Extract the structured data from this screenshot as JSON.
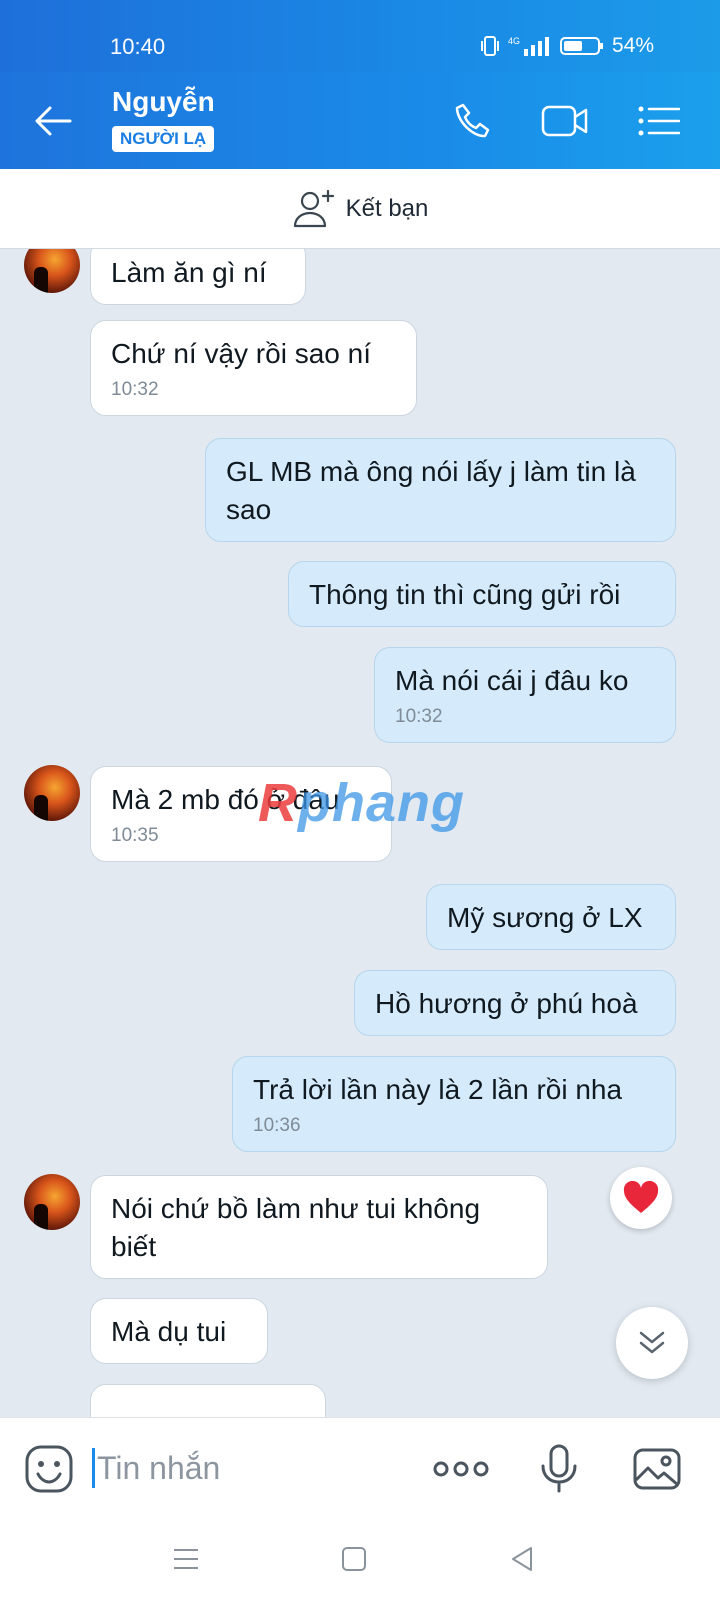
{
  "status": {
    "time": "10:40",
    "network": "4G",
    "battery": "54%"
  },
  "header": {
    "contact_name": "Nguyễn",
    "badge": "NGƯỜI LẠ"
  },
  "friend_bar": {
    "label": "Kết bạn"
  },
  "messages": [
    {
      "side": "in",
      "text": "Làm ăn gì ní",
      "time": ""
    },
    {
      "side": "in",
      "text": "Chứ ní vậy rồi sao ní",
      "time": "10:32"
    },
    {
      "side": "out",
      "text": "GL MB mà ông nói lấy j làm tin là sao",
      "time": ""
    },
    {
      "side": "out",
      "text": "Thông tin thì cũng gửi rồi",
      "time": ""
    },
    {
      "side": "out",
      "text": "Mà nói cái j đâu ko",
      "time": "10:32"
    },
    {
      "side": "in",
      "text": "Mà 2 mb đó ở đâu",
      "time": "10:35"
    },
    {
      "side": "out",
      "text": "Mỹ sương ở LX",
      "time": ""
    },
    {
      "side": "out",
      "text": "Hồ hương ở phú hoà",
      "time": ""
    },
    {
      "side": "out",
      "text": "Trả lời lần này là 2 lần rồi nha",
      "time": "10:36"
    },
    {
      "side": "in",
      "text": "Nói chứ bồ làm như tui không biết",
      "time": ""
    },
    {
      "side": "in",
      "text": "Mà dụ tui",
      "time": ""
    }
  ],
  "reaction": "heart-icon",
  "watermark": {
    "part1": "R",
    "part2": "phang"
  },
  "composer": {
    "placeholder": "Tin nhắn"
  },
  "colors": {
    "header": "#1a8be8",
    "bubble_out": "#d5ebfb",
    "bubble_in": "#ffffff",
    "background": "#e2e9f1"
  }
}
